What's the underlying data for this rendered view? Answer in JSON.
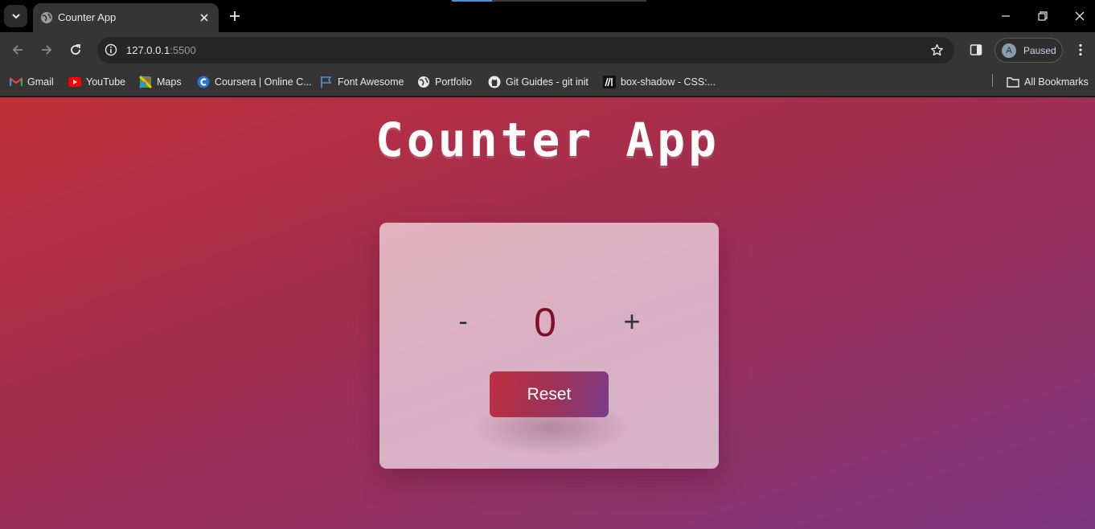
{
  "browser": {
    "tab": {
      "title": "Counter App"
    },
    "address": {
      "host": "127.0.0.1",
      "port": ":5500"
    },
    "profile": {
      "initial": "A",
      "status": "Paused"
    },
    "bookmarks": [
      {
        "label": "Gmail",
        "icon": "gmail-icon"
      },
      {
        "label": "YouTube",
        "icon": "youtube-icon"
      },
      {
        "label": "Maps",
        "icon": "maps-icon"
      },
      {
        "label": "Coursera | Online C...",
        "icon": "coursera-icon"
      },
      {
        "label": "Font Awesome",
        "icon": "flag-icon"
      },
      {
        "label": "Portfolio",
        "icon": "globe-icon"
      },
      {
        "label": "Git Guides - git init",
        "icon": "github-icon"
      },
      {
        "label": "box-shadow - CSS:...",
        "icon": "mdn-icon"
      }
    ],
    "all_bookmarks": "All Bookmarks"
  },
  "app": {
    "heading": "Counter App",
    "decrement_label": "-",
    "count": "0",
    "increment_label": "+",
    "reset_label": "Reset"
  },
  "colors": {
    "page_gradient_start": "#c0303a",
    "page_gradient_end": "#7a3580",
    "card_bg": "#dcb2c2",
    "count_color": "#7e0f2a",
    "reset_gradient_start": "#bf2e41",
    "reset_gradient_end": "#7a3c8c"
  }
}
